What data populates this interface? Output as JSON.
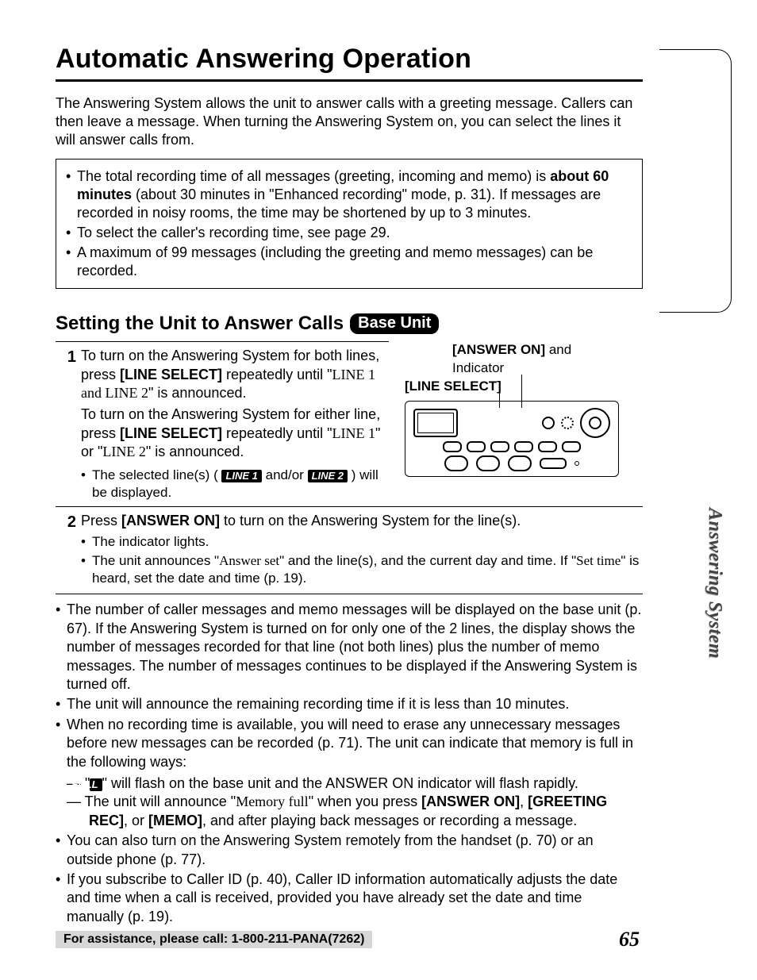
{
  "title": "Automatic Answering Operation",
  "intro": "The Answering System allows the unit to answer calls with a greeting message. Callers can then leave a message. When turning the Answering System on, you can select the lines it will answer calls from.",
  "box": {
    "b1_a": "The total recording time of all messages (greeting, incoming and memo) is ",
    "b1_bold": "about 60 minutes",
    "b1_b": " (about 30 minutes in \"Enhanced recording\" mode, p. 31). If messages are recorded in noisy rooms, the time may be shortened by up to 3 minutes.",
    "b2": "To select the caller's recording time, see page 29.",
    "b3": "A maximum of 99 messages (including the greeting and memo messages) can be recorded."
  },
  "subhead": "Setting the Unit to Answer Calls",
  "subhead_badge": "Base Unit",
  "fig": {
    "label1_a": "[ANSWER ON]",
    "label1_b": " and Indicator",
    "label2": "[LINE SELECT]"
  },
  "steps": {
    "s1": {
      "num": "1",
      "p1_a": "To turn on the Answering System for both lines, press ",
      "p1_key": "[LINE SELECT]",
      "p1_b": " repeatedly until \"",
      "p1_ann": "LINE 1 and LINE 2",
      "p1_c": "\" is announced.",
      "p2_a": "To turn on the Answering System for either line, press ",
      "p2_key": "[LINE SELECT]",
      "p2_b": " repeatedly until \"",
      "p2_ann1": "LINE 1",
      "p2_mid": "\" or \"",
      "p2_ann2": "LINE 2",
      "p2_c": "\" is announced.",
      "sub_a": "The selected line(s) ( ",
      "chip1": "LINE 1",
      "sub_mid": " and/or ",
      "chip2": "LINE 2",
      "sub_b": " ) will be displayed."
    },
    "s2": {
      "num": "2",
      "main_a": "Press ",
      "main_key": "[ANSWER ON]",
      "main_b": " to turn on the Answering System for the line(s).",
      "sub1": "The indicator lights.",
      "sub2_a": "The unit announces \"",
      "sub2_ann1": "Answer set",
      "sub2_b": "\" and the line(s), and the current day and time. If \"",
      "sub2_ann2": "Set time",
      "sub2_c": "\" is heard, set the date and time (p. 19)."
    }
  },
  "notes": {
    "n1": "The number of caller messages and memo messages will be displayed on the base unit (p. 67). If the Answering System is turned on for only one of the 2 lines, the display shows the number of messages recorded for that line (not both lines) plus the number of memo messages. The number of messages continues to be displayed if the Answering System is turned off.",
    "n2": "The unit will announce the remaining recording time if it is less than 10 minutes.",
    "n3": "When no recording time is available, you will need to erase any unnecessary messages before new messages can be recorded (p. 71). The unit can indicate that memory is full in the following ways:",
    "n3d1_a": "— \"",
    "n3d1_chip": "FULL",
    "n3d1_b": "\" will flash on the base unit and the ANSWER ON indicator will flash rapidly.",
    "n3d2_a": "— The unit will announce \"",
    "n3d2_ann": "Memory full",
    "n3d2_b": "\" when you press ",
    "n3d2_k1": "[ANSWER ON]",
    "n3d2_mid1": ", ",
    "n3d2_k2": "[GREETING REC]",
    "n3d2_mid2": ", or ",
    "n3d2_k3": "[MEMO]",
    "n3d2_c": ", and after playing back messages or recording a message.",
    "n4": "You can also turn on the Answering System remotely from the handset (p. 70) or an outside phone (p. 77).",
    "n5": "If you subscribe to Caller ID (p. 40), Caller ID information automatically adjusts the date and time when a call is received, provided you have already set the date and time manually (p. 19)."
  },
  "footer": "For assistance, please call: 1-800-211-PANA(7262)",
  "page_number": "65",
  "side_tab": "Answering System"
}
